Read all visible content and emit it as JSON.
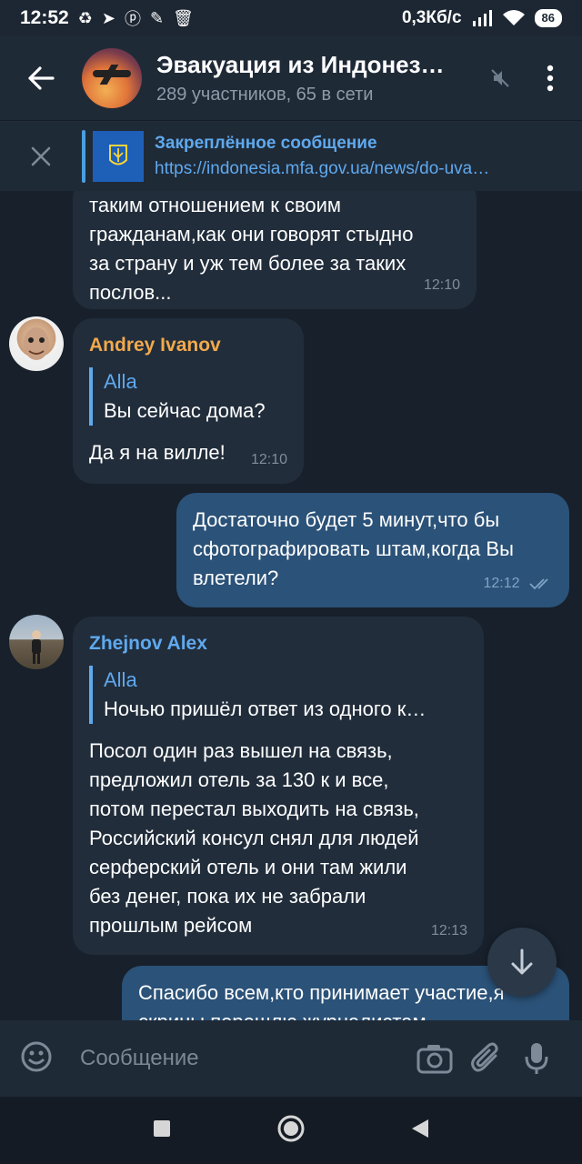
{
  "status_bar": {
    "time": "12:52",
    "net_speed": "0,3Кб/с",
    "battery": "86"
  },
  "header": {
    "title": "Эвакуация из Индонез…",
    "subtitle": "289 участников, 65 в сети"
  },
  "pinned": {
    "label": "Закреплённое сообщение",
    "url": "https://indonesia.mfa.gov.ua/news/do-uva…"
  },
  "messages": [
    {
      "text": "таким отношением к своим\nгражданам,как они говорят стыдно\nза страну и уж тем более за таких\nпослов...",
      "time": "12:10"
    },
    {
      "sender": "Andrey Ivanov",
      "sender_color": "#f2a94b",
      "reply_name": "Alla",
      "reply_text": "Вы сейчас дома?",
      "text": "Да я на вилле!",
      "time": "12:10"
    },
    {
      "outgoing": true,
      "text": "Достаточно будет 5 минут,что бы\nсфотографировать штам,когда Вы\nвлетели?",
      "time": "12:12"
    },
    {
      "sender": "Zhejnov Alex",
      "sender_color": "#5fa9ee",
      "reply_name": "Alla",
      "reply_text": "Ночью пришёл ответ из одного к…",
      "text": "Посол один раз вышел на связь,\nпредложил отель за 130 к и все,\nпотом перестал выходить на связь,\nРоссийский консул снял для людей\nсерферский отель и они там жили\nбез денег, пока их не забрали\nпрошлым рейсом",
      "time": "12:13"
    },
    {
      "outgoing": true,
      "text": "Спасибо всем,кто  принимает участие,я\nскрины перешлю журналистам"
    }
  ],
  "input": {
    "placeholder": "Сообщение"
  },
  "colors": {
    "background": "#17202b",
    "incoming_bubble": "#212d3b",
    "outgoing_bubble": "#2b5278",
    "accent": "#5fa9ee"
  }
}
